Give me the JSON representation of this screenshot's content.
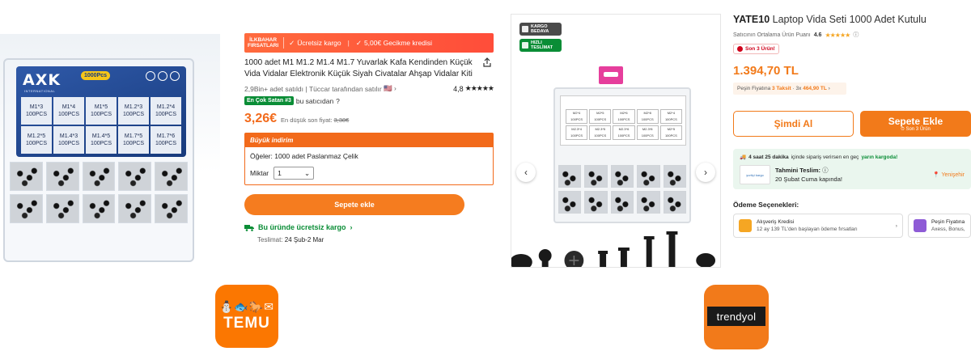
{
  "temu": {
    "image": {
      "brand": "AXK",
      "brand_sub": "INTERNATIONAL",
      "pcs_badge": "1000Pcs",
      "sizes": [
        {
          "size": "M1*3",
          "count": "100PCS"
        },
        {
          "size": "M1*4",
          "count": "100PCS"
        },
        {
          "size": "M1*5",
          "count": "100PCS"
        },
        {
          "size": "M1.2*3",
          "count": "100PCS"
        },
        {
          "size": "M1.2*4",
          "count": "100PCS"
        },
        {
          "size": "M1.2*5",
          "count": "100PCS"
        },
        {
          "size": "M1.4*3",
          "count": "100PCS"
        },
        {
          "size": "M1.4*5",
          "count": "100PCS"
        },
        {
          "size": "M1.7*5",
          "count": "100PCS"
        },
        {
          "size": "M1.7*6",
          "count": "100PCS"
        }
      ]
    },
    "promo": {
      "tag_line1": "İLKBAHAR",
      "tag_line2": "FIRSATLARI",
      "free_shipping": "Ücretsiz kargo",
      "delay_credit": "5,00€ Gecikme kredisi"
    },
    "title": "1000 adet M1 M1.2 M1.4 M1.7 Yuvarlak Kafa Kendinden Küçük Vida Vidalar Elektronik Küçük Siyah Civatalar Ahşap Vidalar Kiti",
    "sold": "2,9Bin+ adet satıldı",
    "seller": "Tüccar tarafından satılır",
    "rating": "4,8",
    "stars": "★★★★★",
    "bestseller_badge": "En Çok Satan #3",
    "bestseller_text": "bu satıcıdan",
    "price": "3,26€",
    "price_note": "En düşük son fiyat:",
    "old_price": "3,38€",
    "bulk": {
      "header": "Büyük indirim",
      "option_label": "Öğeler: 1000 adet Paslanmaz Çelik",
      "qty_label": "Miktar",
      "qty_value": "1"
    },
    "add_to_cart": "Sepete ekle",
    "free_ship_line": "Bu üründe ücretsiz kargo",
    "delivery_label": "Teslimat:",
    "delivery_dates": "24 Şub-2 Mar",
    "logo_glyphs": "⛄🐟🐎✉",
    "logo_word": "TEMU"
  },
  "trendyol": {
    "badges": {
      "cargo_l1": "KARGO",
      "cargo_l2": "BEDAVA",
      "fast_l1": "HIZLI",
      "fast_l2": "TESLİMAT"
    },
    "image": {
      "sticker_cells": [
        "M2*4",
        "M2*5",
        "M2*6",
        "M2*8",
        "M2*4",
        "M2.3*4",
        "M2.3*5",
        "M2.3*6",
        "M2.3*8",
        "M2*5"
      ],
      "sticker_count": "100PCS"
    },
    "nav": {
      "prev": "‹",
      "next": "›"
    },
    "brand": "YATE10",
    "title": "Laptop Vida Seti 1000 Adet Kutulu",
    "seller_rating_label": "Satıcının Ortalama Ürün Puanı",
    "seller_rating": "4.6",
    "stars": "★★★★★",
    "last_items": "Son 3 Ürün!",
    "price": "1.394,70 TL",
    "installment": {
      "prefix": "Peşin Fiyatına",
      "taksit": "3 Taksit",
      "mid": "· 3x",
      "amount": "464,90 TL"
    },
    "buy_now": "Şimdi Al",
    "add_to_cart": "Sepete Ekle",
    "add_to_cart_sub": "Son 3 Ürün",
    "cargo": {
      "time": "4 saat 25 dakika",
      "text": "içinde sipariş verirsen en geç",
      "highlight": "yarın kargoda!",
      "carrier": "yurtiçi kargo",
      "eta_label": "Tahmini Teslim:",
      "eta_value": "20 Şubat Cuma kapında!",
      "location": "Yenişehir"
    },
    "payment": {
      "title": "Ödeme Seçenekleri:",
      "option1_title": "Alışveriş Kredisi",
      "option1_sub": "12 ay 139 TL'den başlayan ödeme fırsatları",
      "option2_title": "Peşin Fiyatına",
      "option2_sub": "Axess, Bonus,"
    },
    "logo_word": "trendyol"
  },
  "colors": {
    "temu_orange": "#fb7701",
    "temu_button": "#f57c1f",
    "temu_price": "#f26a1b",
    "temu_green": "#0a8d36",
    "trendyol_orange": "#f27a1a",
    "trendyol_green": "#0a8d36",
    "alert_red": "#d0021b"
  }
}
